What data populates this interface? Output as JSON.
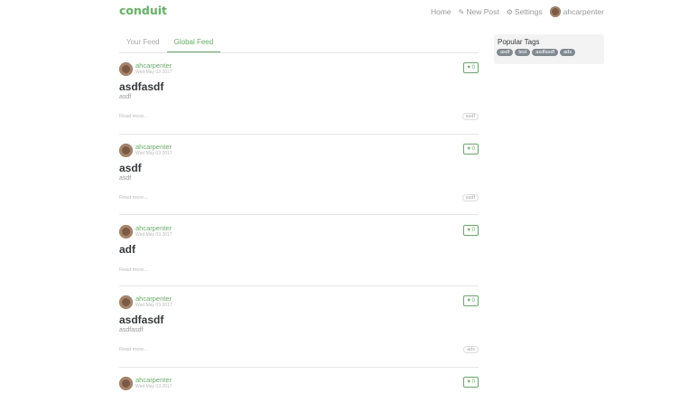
{
  "brand": "conduit",
  "nav": {
    "home": "Home",
    "new_post": "New Post",
    "settings": "Settings",
    "username": "ahcarpenter"
  },
  "tabs": [
    {
      "label": "Your Feed",
      "active": false
    },
    {
      "label": "Global Feed",
      "active": true
    }
  ],
  "popular_tags": {
    "title": "Popular Tags",
    "tags": [
      "asdf",
      "test",
      "asdfasdf",
      "ads"
    ]
  },
  "articles": [
    {
      "author": "ahcarpenter",
      "date": "Wed May 03 2017",
      "favorites": "0",
      "title": "asdfasdf",
      "description": "asdf",
      "read_more": "Read more...",
      "tag": "asdf"
    },
    {
      "author": "ahcarpenter",
      "date": "Wed May 03 2017",
      "favorites": "0",
      "title": "asdf",
      "description": "asdf",
      "read_more": "Read more...",
      "tag": "asdf"
    },
    {
      "author": "ahcarpenter",
      "date": "Wed May 03 2017",
      "favorites": "0",
      "title": "adf",
      "description": "",
      "read_more": "Read more...",
      "tag": ""
    },
    {
      "author": "ahcarpenter",
      "date": "Wed May 03 2017",
      "favorites": "0",
      "title": "asdfasdf",
      "description": "asdfasdf",
      "read_more": "Read more...",
      "tag": "ads"
    },
    {
      "author": "ahcarpenter",
      "date": "Wed May 03 2017",
      "favorites": "0",
      "title": "",
      "description": "",
      "read_more": "",
      "tag": ""
    }
  ]
}
